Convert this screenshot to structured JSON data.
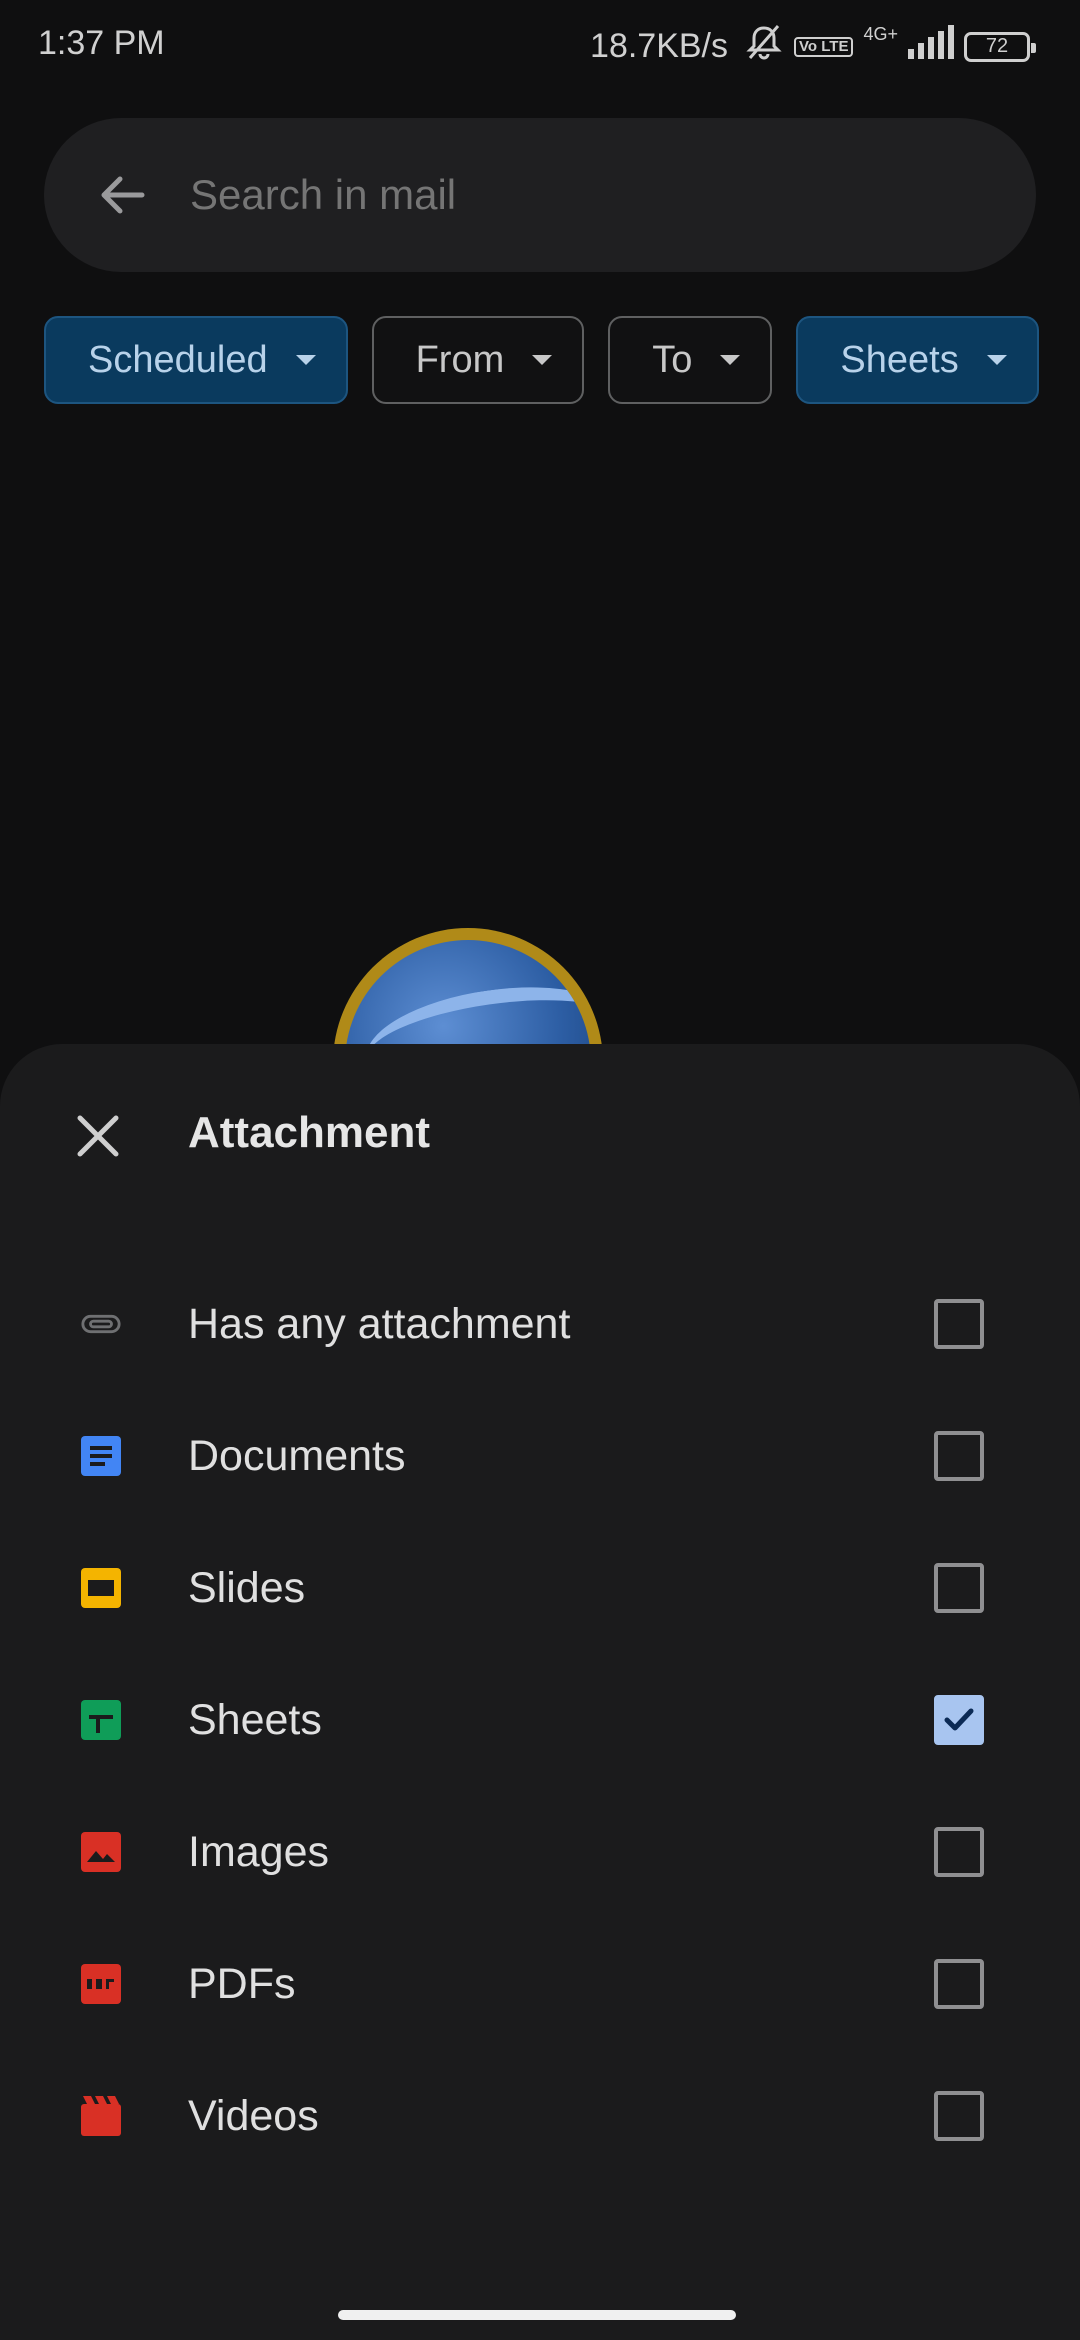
{
  "status_bar": {
    "time": "1:37 PM",
    "network_speed": "18.7KB/s",
    "volte_label": "Vo LTE",
    "network_type": "4G+",
    "battery": "72"
  },
  "search": {
    "placeholder": "Search in mail"
  },
  "chips": [
    {
      "label": "Scheduled",
      "active": true
    },
    {
      "label": "From",
      "active": false
    },
    {
      "label": "To",
      "active": false
    },
    {
      "label": "Sheets",
      "active": true
    }
  ],
  "sheet": {
    "title": "Attachment",
    "options": [
      {
        "label": "Has any attachment",
        "icon": "paperclip-icon",
        "color": "#6f7072",
        "checked": false
      },
      {
        "label": "Documents",
        "icon": "docs-icon",
        "color": "#4285f4",
        "checked": false
      },
      {
        "label": "Slides",
        "icon": "slides-icon",
        "color": "#f4b400",
        "checked": false
      },
      {
        "label": "Sheets",
        "icon": "sheets-icon",
        "color": "#0f9d58",
        "checked": true
      },
      {
        "label": "Images",
        "icon": "image-icon",
        "color": "#d93025",
        "checked": false
      },
      {
        "label": "PDFs",
        "icon": "pdf-icon",
        "color": "#d93025",
        "checked": false
      },
      {
        "label": "Videos",
        "icon": "video-icon",
        "color": "#d93025",
        "checked": false
      }
    ]
  },
  "colors": {
    "active_chip_bg": "#0a3a5e",
    "checkbox_checked": "#a8c5f0",
    "sheet_bg": "#1b1b1c"
  }
}
